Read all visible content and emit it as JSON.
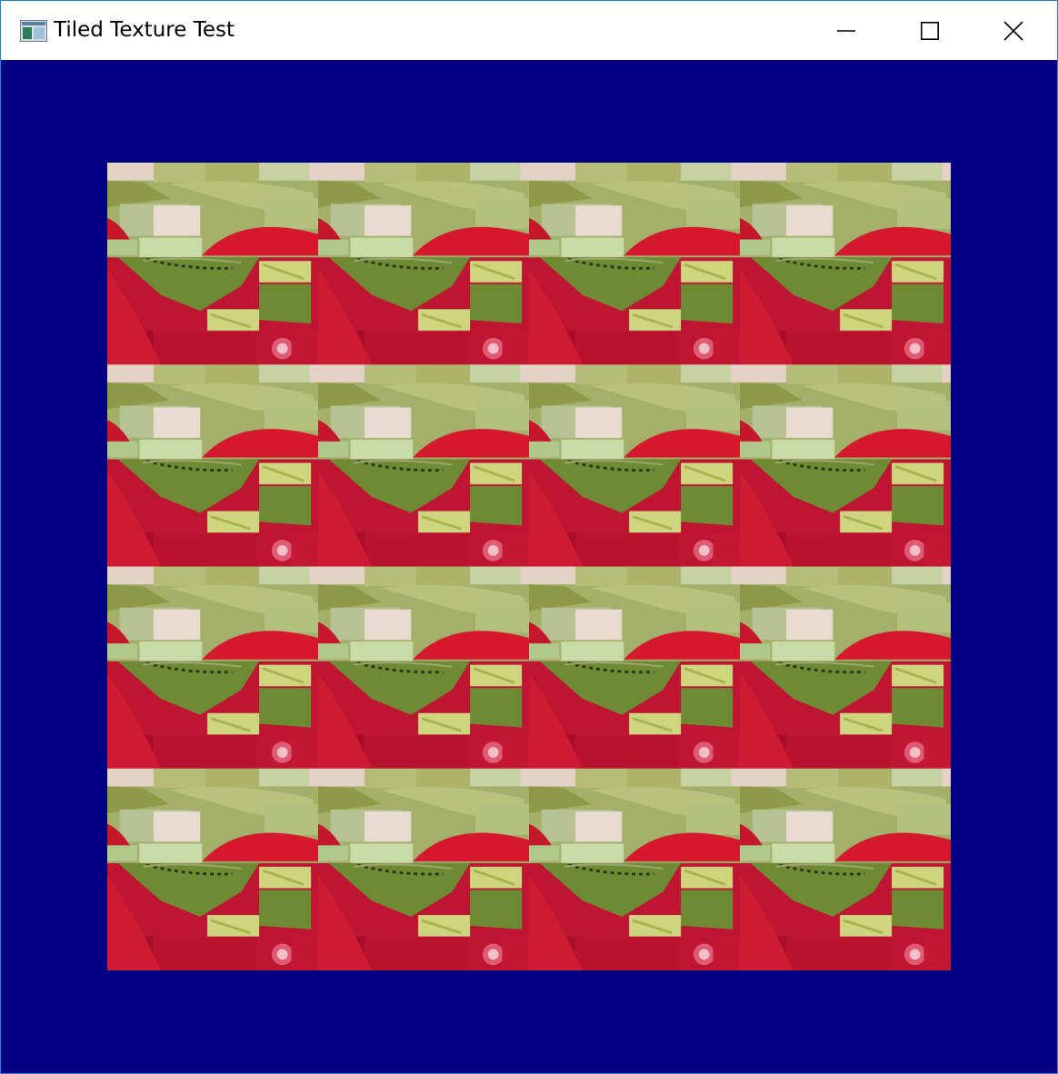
{
  "window": {
    "title": "Tiled Texture Test",
    "accent_border": "#1883d7"
  },
  "titlebar": {
    "icon": "app-window-icon",
    "buttons": [
      {
        "name": "minimize",
        "icon": "minimize-icon"
      },
      {
        "name": "maximize",
        "icon": "maximize-icon"
      },
      {
        "name": "close",
        "icon": "close-icon"
      }
    ]
  },
  "scene": {
    "clear_color": "#000080",
    "texture": "apple-photo-texture",
    "tile_columns": 4,
    "tile_rows": 4
  }
}
